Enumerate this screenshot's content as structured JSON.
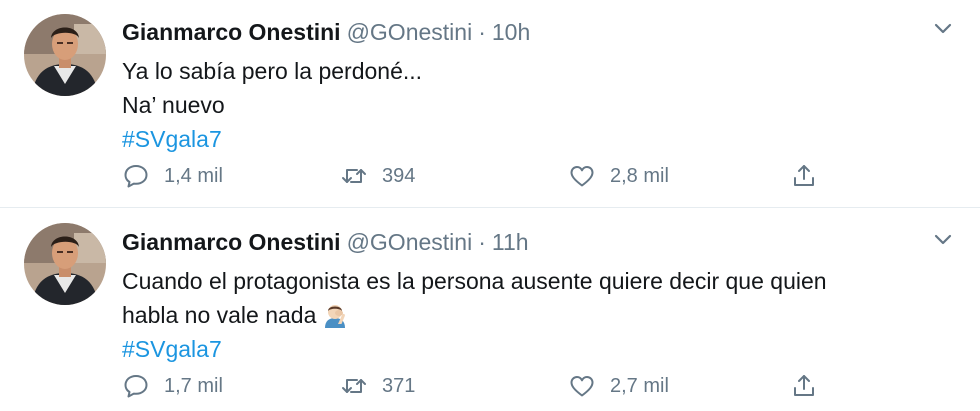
{
  "tweets": [
    {
      "author_name": "Gianmarco Onestini",
      "handle": "@GOnestini",
      "separator": "·",
      "time": "10h",
      "lines": [
        "Ya lo sabía pero la perdoné...",
        "Na’ nuevo"
      ],
      "hashtag": "#SVgala7",
      "replies": "1,4 mil",
      "retweets": "394",
      "likes": "2,8 mil"
    },
    {
      "author_name": "Gianmarco Onestini",
      "handle": "@GOnestini",
      "separator": "·",
      "time": "11h",
      "lines": [
        "Cuando el protagonista es la persona ausente quiere decir que quien",
        "habla no vale nada"
      ],
      "emoji": "man-facepalming-emoji",
      "hashtag": "#SVgala7",
      "replies": "1,7 mil",
      "retweets": "371",
      "likes": "2,7 mil"
    }
  ],
  "colors": {
    "text": "#14171a",
    "secondary": "#657786",
    "link": "#1b95e0",
    "divider": "#e6ecf0"
  },
  "icons": [
    "chevron-down-icon",
    "reply-icon",
    "retweet-icon",
    "like-icon",
    "share-icon"
  ]
}
